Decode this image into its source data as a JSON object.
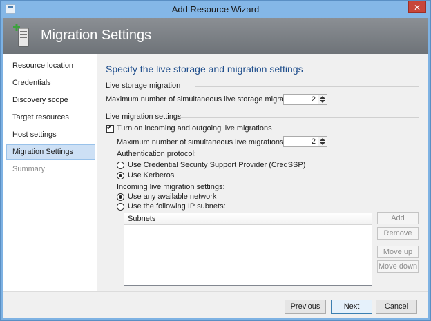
{
  "window": {
    "title": "Add Resource Wizard",
    "close_glyph": "✕"
  },
  "header": {
    "title": "Migration Settings",
    "icon": "server-add-icon"
  },
  "nav": {
    "items": [
      {
        "label": "Resource location"
      },
      {
        "label": "Credentials"
      },
      {
        "label": "Discovery scope"
      },
      {
        "label": "Target resources"
      },
      {
        "label": "Host settings"
      },
      {
        "label": "Migration Settings"
      },
      {
        "label": "Summary"
      }
    ],
    "selected": "Migration Settings"
  },
  "main": {
    "heading": "Specify the live storage and migration settings",
    "storage": {
      "section": "Live storage migration",
      "max_label": "Maximum number of simultaneous live storage migrations:",
      "max_value": "2"
    },
    "live": {
      "section": "Live migration settings",
      "enable_label": "Turn on incoming and outgoing live migrations",
      "max_label": "Maximum number of simultaneous live migrations:",
      "max_value": "2",
      "auth_label": "Authentication protocol:",
      "auth_credssp": "Use Credential Security Support Provider (CredSSP)",
      "auth_kerberos": "Use Kerberos",
      "incoming_label": "Incoming live migration settings:",
      "any_network": "Use any available network",
      "ip_subnets": "Use the following IP subnets:"
    },
    "subnets": {
      "header": "Subnets",
      "add": "Add",
      "remove": "Remove",
      "move_up": "Move up",
      "move_down": "Move down"
    }
  },
  "footer": {
    "previous": "Previous",
    "next": "Next",
    "cancel": "Cancel"
  },
  "colors": {
    "accent": "#1f4e8c",
    "titlebar": "#84b7e7",
    "header_bg": "#7c8085",
    "selected_nav": "#cde0f5"
  }
}
